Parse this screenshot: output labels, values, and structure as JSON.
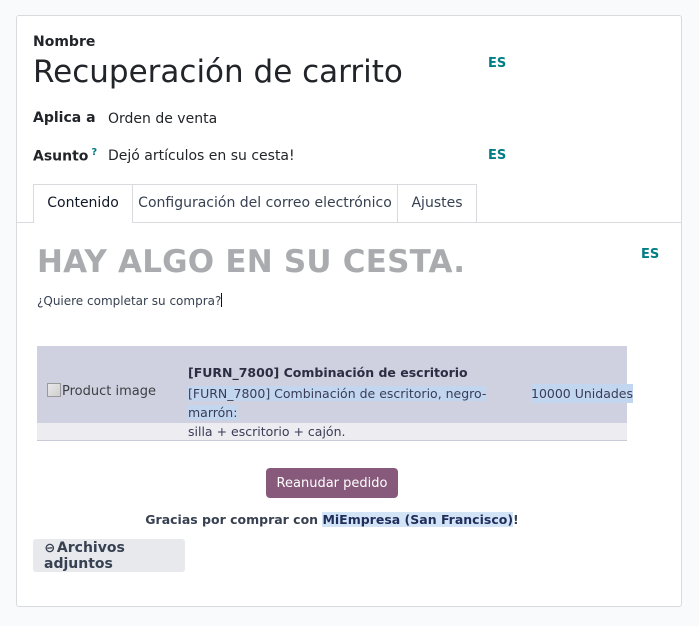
{
  "form": {
    "name_label": "Nombre",
    "name_value": "Recuperación de carrito",
    "applies_label": "Aplica a",
    "applies_value": "Orden de venta",
    "subject_label": "Asunto",
    "subject_help": "?",
    "subject_value": "Dejó artículos en su cesta!",
    "lang_badge": "ES"
  },
  "tabs": [
    {
      "label": "Contenido",
      "active": true
    },
    {
      "label": "Configuración del correo electrónico",
      "active": false
    },
    {
      "label": "Ajustes",
      "active": false
    }
  ],
  "email": {
    "lang_badge": "ES",
    "heading": "HAY ALGO EN SU CESTA.",
    "question": "¿Quiere completar su compra?",
    "product": {
      "image_alt": "Product image",
      "name": "[FURN_7800] Combinación de escritorio",
      "description_line1": "[FURN_7800] Combinación de escritorio, negro-marrón:",
      "description_line2": "silla + escritorio + cajón.",
      "quantity": "10000 Unidades"
    },
    "resume_button": "Reanudar pedido",
    "thanks_prefix": "Gracias por comprar con ",
    "thanks_company": "MiEmpresa (San Francisco)",
    "thanks_suffix": "!"
  },
  "attachments_button": "Archivos adjuntos",
  "colors": {
    "accent_teal": "#017e84",
    "primary_button": "#875a7b",
    "heading_gray": "#a9abae"
  },
  "icons": {
    "attachment": "paperclip-icon",
    "broken_image": "broken-image-icon"
  }
}
